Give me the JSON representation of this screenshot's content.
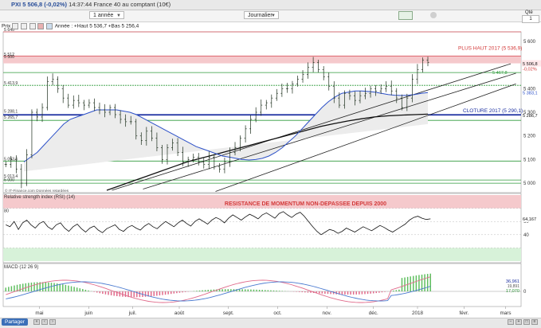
{
  "header": {
    "index_name": "PXI",
    "quote": "5 506,8 (-0,02%)",
    "detail": "14:37:44 France 40 au comptant (10€)"
  },
  "toolbar": {
    "period": "1 année",
    "interval": "Journalier",
    "qty_label": "Qté",
    "qty_value": "1"
  },
  "legend": {
    "label": "Prix",
    "text": "Année : +Haut 5 536,7 +Bas 5 256,4"
  },
  "bottom": {
    "share_label": "Partager"
  },
  "watermark": "© IT-Finance.com Données retardées",
  "chart_data": [
    {
      "type": "line",
      "panel": "price",
      "x_labels": [
        "mai",
        "juin",
        "juil.",
        "août",
        "sept.",
        "oct.",
        "nov.",
        "déc.",
        "2018",
        "févr.",
        "mars"
      ],
      "ylim": [
        4960,
        5640
      ],
      "y_ticks": [
        5000,
        5100,
        5200,
        5300,
        5400,
        5500,
        5600
      ],
      "grid": true,
      "close": [
        5080,
        5100,
        5060,
        5000,
        5120,
        5300,
        5280,
        5320,
        5430,
        5440,
        5400,
        5360,
        5330,
        5350,
        5340,
        5330,
        5340,
        5320,
        5310,
        5300,
        5320,
        5290,
        5270,
        5260,
        5260,
        5200,
        5180,
        5220,
        5190,
        5150,
        5100,
        5150,
        5170,
        5130,
        5090,
        5100,
        5110,
        5090,
        5080,
        5110,
        5070,
        5060,
        5090,
        5130,
        5150,
        5190,
        5230,
        5270,
        5300,
        5330,
        5340,
        5360,
        5380,
        5400,
        5400,
        5420,
        5440,
        5460,
        5490,
        5510,
        5480,
        5450,
        5410,
        5360,
        5330,
        5380,
        5370,
        5350,
        5370,
        5380,
        5400,
        5390,
        5400,
        5410,
        5390,
        5360,
        5320,
        5360,
        5440,
        5480,
        5520,
        5510
      ],
      "ma_blue": [
        5090,
        5110,
        5130,
        5160,
        5190,
        5220,
        5250,
        5270,
        5280,
        5290,
        5300,
        5310,
        5310,
        5310,
        5310,
        5305,
        5300,
        5290,
        5275,
        5260,
        5245,
        5230,
        5215,
        5200,
        5185,
        5170,
        5155,
        5145,
        5135,
        5125,
        5115,
        5110,
        5105,
        5100,
        5098,
        5100,
        5105,
        5115,
        5130,
        5150,
        5175,
        5200,
        5230,
        5260,
        5290,
        5320,
        5345,
        5365,
        5380,
        5385,
        5390,
        5390,
        5388,
        5385,
        5380,
        5375,
        5372,
        5371,
        5372,
        5375,
        5380,
        5383
      ],
      "ma_black": [
        4970,
        4990,
        5010,
        5030,
        5050,
        5070,
        5090,
        5105,
        5120,
        5135,
        5150,
        5165,
        5180,
        5195,
        5210,
        5225,
        5240,
        5252,
        5263,
        5272,
        5280,
        5285,
        5288,
        5290,
        5292
      ],
      "support_lines": [
        {
          "from": [
            0.21,
            4970
          ],
          "to": [
            0.98,
            5505
          ]
        },
        {
          "from": [
            0.27,
            4975
          ],
          "to": [
            0.99,
            5465
          ]
        },
        {
          "from": [
            0.41,
            4965
          ],
          "to": [
            0.99,
            5420
          ]
        }
      ],
      "h_lines": [
        5536.9,
        5467.8,
        5413.9,
        5290.1,
        5288.1,
        5265.7,
        5093.6,
        5013.4,
        5000
      ],
      "resistance_zone": [
        5506.8,
        5540
      ],
      "labels": {
        "high_2017": "PLUS HAUT 2017 (5 536,9)",
        "close_2017": "CLOTURE 2017 (5 290,1)",
        "last": "5 506,8",
        "change": "-0,02%",
        "v_5467": "5 467,8",
        "v_5383": "5 383,1",
        "v_5286": "5 286,7",
        "left_5640": "5 640",
        "left_5512": "5 512",
        "left_5500": "5 500",
        "left_5413": "5 413,9",
        "left_5288": "5 288,1",
        "left_5265": "5 265,7",
        "left_5093": "5 093,6",
        "left_5013": "5 013,4",
        "left_5000": "5 000"
      }
    },
    {
      "type": "line",
      "panel": "rsi",
      "title": "Relative strength index (RSI) (14)",
      "banner": "RESISTANCE DE MOMENTUM NON-DEPASSEE DEPUIS 2000",
      "ylim": [
        0,
        100
      ],
      "y_ticks": [
        40,
        60
      ],
      "last_label": "64,167",
      "left_80": "80",
      "values": [
        55,
        52,
        60,
        48,
        58,
        62,
        55,
        50,
        57,
        60,
        52,
        48,
        55,
        58,
        50,
        45,
        52,
        56,
        49,
        44,
        50,
        53,
        47,
        43,
        49,
        52,
        55,
        48,
        45,
        51,
        54,
        50,
        47,
        53,
        57,
        52,
        49,
        55,
        60,
        56,
        52,
        58,
        62,
        57,
        53,
        60,
        64,
        60,
        56,
        62,
        66,
        63,
        58,
        65,
        70,
        66,
        62,
        67,
        71,
        68,
        64,
        70,
        73,
        69,
        65,
        72,
        75,
        70,
        66,
        71,
        74,
        68,
        60,
        52,
        45,
        40,
        44,
        48,
        46,
        42,
        45,
        50,
        47,
        44,
        48,
        52,
        49,
        46,
        50,
        54,
        51,
        47,
        44,
        48,
        52,
        56,
        62,
        66,
        68,
        65,
        63,
        64
      ]
    },
    {
      "type": "bar",
      "panel": "macd",
      "title": "MACD (12 26 9)",
      "y_ticks": [
        0
      ],
      "last_macd": "36,961",
      "last_signal": "19,891",
      "last_hist": "17,070"
    }
  ]
}
